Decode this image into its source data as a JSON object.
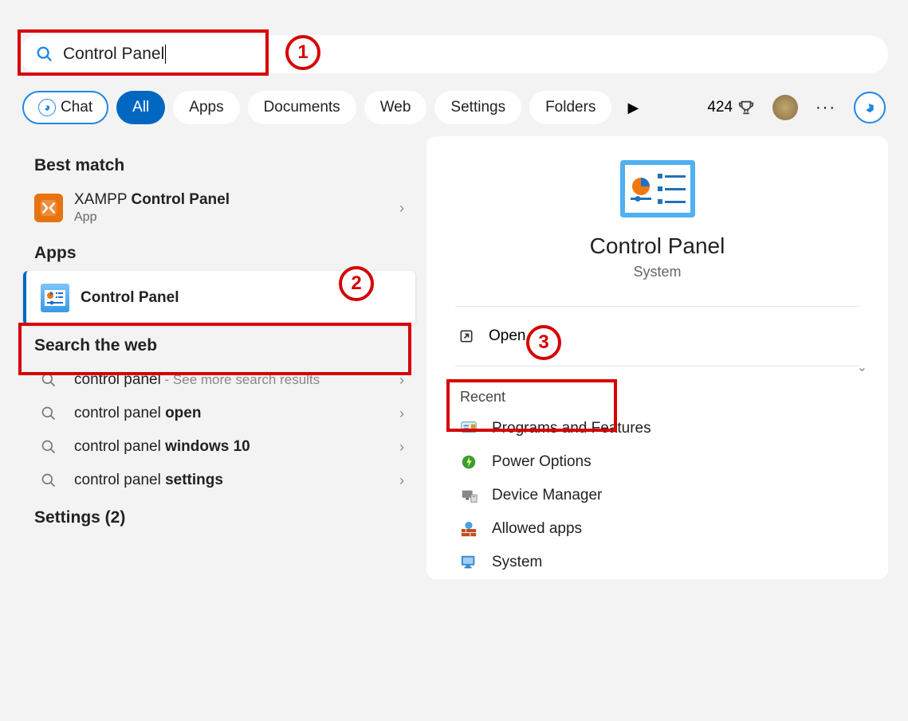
{
  "search": {
    "value": "Control Panel"
  },
  "tabs": {
    "chat": "Chat",
    "all": "All",
    "apps": "Apps",
    "documents": "Documents",
    "web": "Web",
    "settings": "Settings",
    "folders": "Folders"
  },
  "rewards": {
    "count": "424"
  },
  "annotations": {
    "a1": "1",
    "a2": "2",
    "a3": "3"
  },
  "left": {
    "best_match_header": "Best match",
    "best_match": {
      "title_pre": "XAMPP ",
      "title_bold": "Control Panel",
      "sub": "App"
    },
    "apps_header": "Apps",
    "app_item": {
      "title": "Control Panel"
    },
    "web_header": "Search the web",
    "web": [
      {
        "pre": "control panel",
        "bold": "",
        "sub": " - See more search results"
      },
      {
        "pre": "control panel ",
        "bold": "open",
        "sub": ""
      },
      {
        "pre": "control panel ",
        "bold": "windows 10",
        "sub": ""
      },
      {
        "pre": "control panel ",
        "bold": "settings",
        "sub": ""
      }
    ],
    "settings_header": "Settings (2)"
  },
  "right": {
    "title": "Control Panel",
    "sub": "System",
    "open": "Open",
    "recent_header": "Recent",
    "recent": [
      {
        "label": "Programs and Features"
      },
      {
        "label": "Power Options"
      },
      {
        "label": "Device Manager"
      },
      {
        "label": "Allowed apps"
      },
      {
        "label": "System"
      }
    ]
  }
}
